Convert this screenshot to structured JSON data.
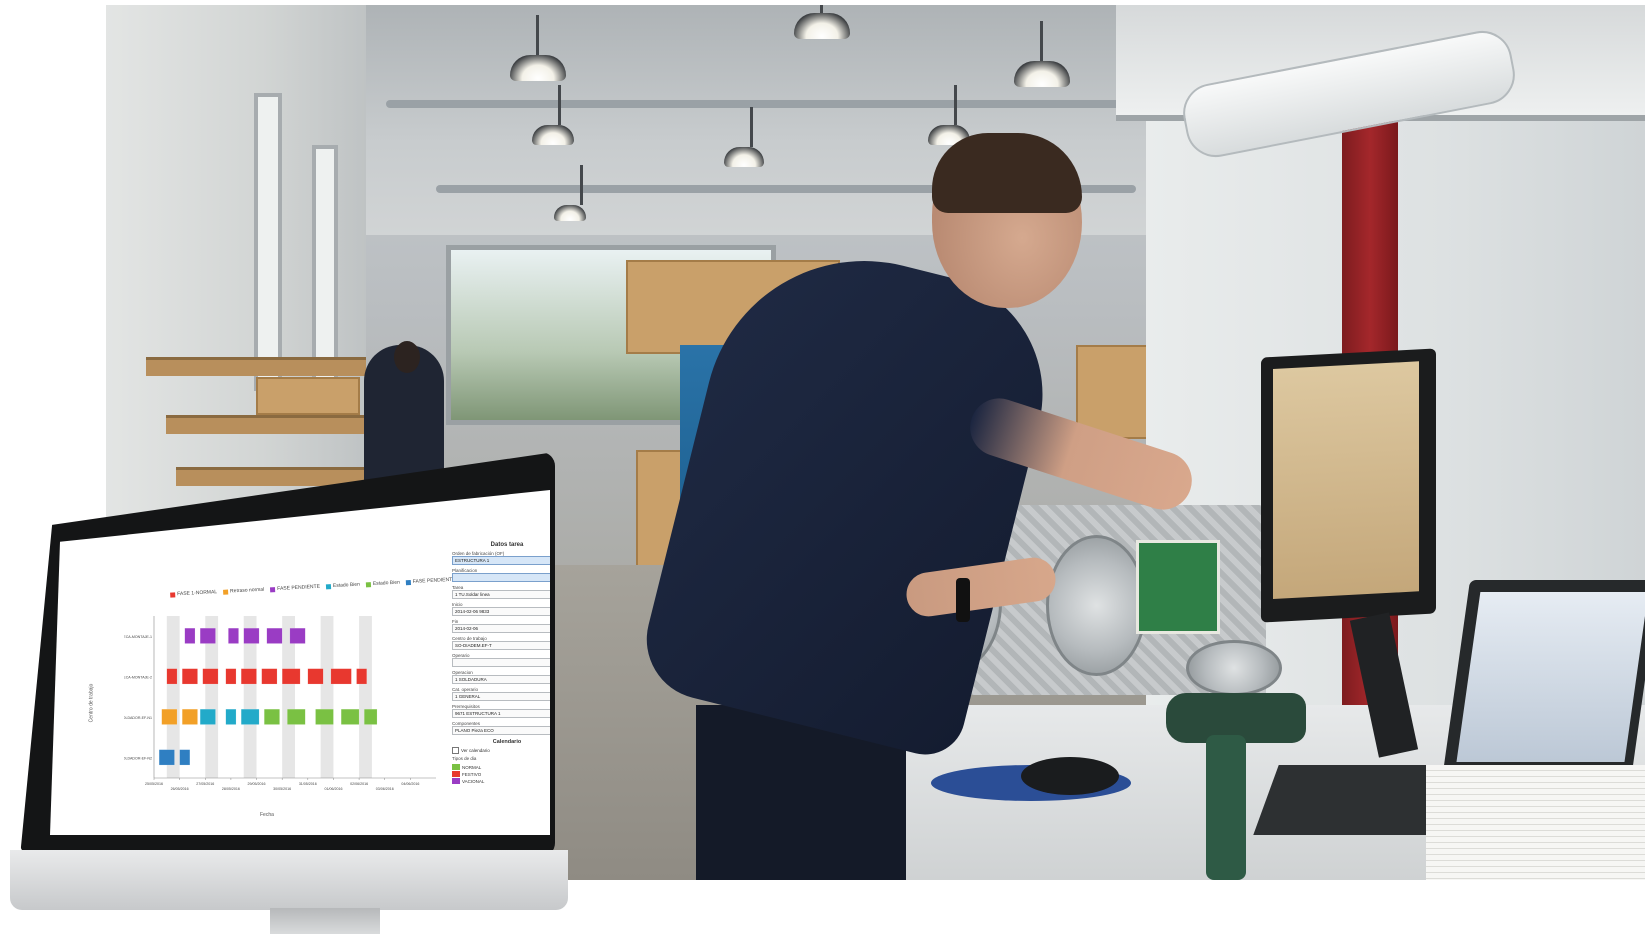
{
  "colors": {
    "normal": "#e8382f",
    "retraso": "#f2a027",
    "pendiente": "#9a3cc4",
    "estado_bien": "#22aac9",
    "estado_ok": "#2f7fc2",
    "festivo": "#7ac143",
    "shaded_band": "#e6e6e6"
  },
  "app": {
    "legend": [
      {
        "label": "FASE 1-NORMAL",
        "color": "#e8382f"
      },
      {
        "label": "Retraso normal",
        "color": "#f2a027"
      },
      {
        "label": "FASE PENDIENTE",
        "color": "#9a3cc4"
      },
      {
        "label": "Estado Bien",
        "color": "#22aac9"
      },
      {
        "label": "Estado Bien",
        "color": "#7ac143"
      },
      {
        "label": "FASE PENDIENTE",
        "color": "#2f7fc2"
      }
    ],
    "x_axis_label": "Fecha",
    "y_axis_label": "Centro de trabajo",
    "panel": {
      "title": "Datos tarea",
      "fields": [
        {
          "label": "Orden de fabricación (OF)",
          "value": "ESTRUCTURA 1",
          "highlight": true
        },
        {
          "label": "Planificacion",
          "value": "",
          "highlight": true
        },
        {
          "label": "Tarea",
          "value": "1  TU.Soldar linea",
          "highlight": false
        },
        {
          "label": "Inicio",
          "value": "2014-02-06        9833",
          "highlight": false
        },
        {
          "label": "Fin",
          "value": "2014-02-06",
          "highlight": false
        },
        {
          "label": "Centro de trabajo",
          "value": "SO-DIADEM.EF-T",
          "highlight": false
        },
        {
          "label": "Operario",
          "value": "",
          "highlight": false
        },
        {
          "label": "Operacion",
          "value": "1  SOLDADURA",
          "highlight": false
        },
        {
          "label": "Cat. operario",
          "value": "1  GENERAL",
          "highlight": false
        },
        {
          "label": "Prerrequisitos",
          "value": "9671  ESTRUCTURA 1",
          "highlight": false
        },
        {
          "label": "Componentes",
          "value": "PLANO  Pieza ECO",
          "highlight": false
        }
      ],
      "calendar_title": "Calendario",
      "calendar_checkbox": "Ver calendario",
      "day_types_label": "Tipos de dia",
      "day_types": [
        {
          "label": "NORMAL",
          "color": "#7ac143"
        },
        {
          "label": "FESTIVO",
          "color": "#e8382f"
        },
        {
          "label": "VACIONAL",
          "color": "#9a3cc4"
        }
      ]
    }
  },
  "chart_data": {
    "type": "bar",
    "title": "",
    "xlabel": "Fecha",
    "ylabel": "Centro de trabajo",
    "categories": [
      "MECA-MONTAJE-1",
      "MECA-MONTAJE-2",
      "SOLDADOR-EF-N1",
      "SOLDADOR-EF-N2"
    ],
    "x_ticks": [
      "25/05/2016",
      "26/05/2016",
      "27/05/2016",
      "28/05/2016",
      "29/05/2016",
      "30/05/2016",
      "31/05/2016",
      "01/06/2016",
      "02/06/2016",
      "03/06/2016",
      "04/06/2016"
    ],
    "x_range": [
      0,
      22
    ],
    "series": [
      {
        "category": "MECA-MONTAJE-1",
        "color": "#9a3cc4",
        "bars": [
          [
            2.4,
            3.2
          ],
          [
            3.6,
            4.8
          ],
          [
            5.8,
            6.6
          ],
          [
            7.0,
            8.2
          ],
          [
            8.8,
            10.0
          ],
          [
            10.6,
            11.8
          ]
        ]
      },
      {
        "category": "MECA-MONTAJE-2",
        "color": "#e8382f",
        "bars": [
          [
            1.0,
            1.8
          ],
          [
            2.2,
            3.4
          ],
          [
            3.8,
            5.0
          ],
          [
            5.6,
            6.4
          ],
          [
            6.8,
            8.0
          ],
          [
            8.4,
            9.6
          ],
          [
            10.0,
            11.4
          ],
          [
            12.0,
            13.2
          ],
          [
            13.8,
            15.4
          ],
          [
            15.8,
            16.6
          ]
        ]
      },
      {
        "category": "SOLDADOR-EF-N1",
        "color": "#f2a027",
        "bars": [
          [
            0.6,
            1.8
          ],
          [
            2.2,
            3.4
          ]
        ]
      },
      {
        "category": "SOLDADOR-EF-N1",
        "color": "#22aac9",
        "bars": [
          [
            3.6,
            4.8
          ],
          [
            5.6,
            6.4
          ],
          [
            6.8,
            8.2
          ]
        ]
      },
      {
        "category": "SOLDADOR-EF-N1",
        "color": "#7ac143",
        "bars": [
          [
            8.6,
            9.8
          ],
          [
            10.4,
            11.8
          ],
          [
            12.6,
            14.0
          ],
          [
            14.6,
            16.0
          ],
          [
            16.4,
            17.4
          ]
        ]
      },
      {
        "category": "SOLDADOR-EF-N2",
        "color": "#2f7fc2",
        "bars": [
          [
            0.4,
            1.6
          ],
          [
            2.0,
            2.8
          ]
        ]
      }
    ],
    "shaded_columns": [
      [
        1,
        2
      ],
      [
        4,
        5
      ],
      [
        7,
        8
      ],
      [
        10,
        11
      ],
      [
        13,
        14
      ],
      [
        16,
        17
      ]
    ],
    "grid": false,
    "legend_position": "top"
  }
}
